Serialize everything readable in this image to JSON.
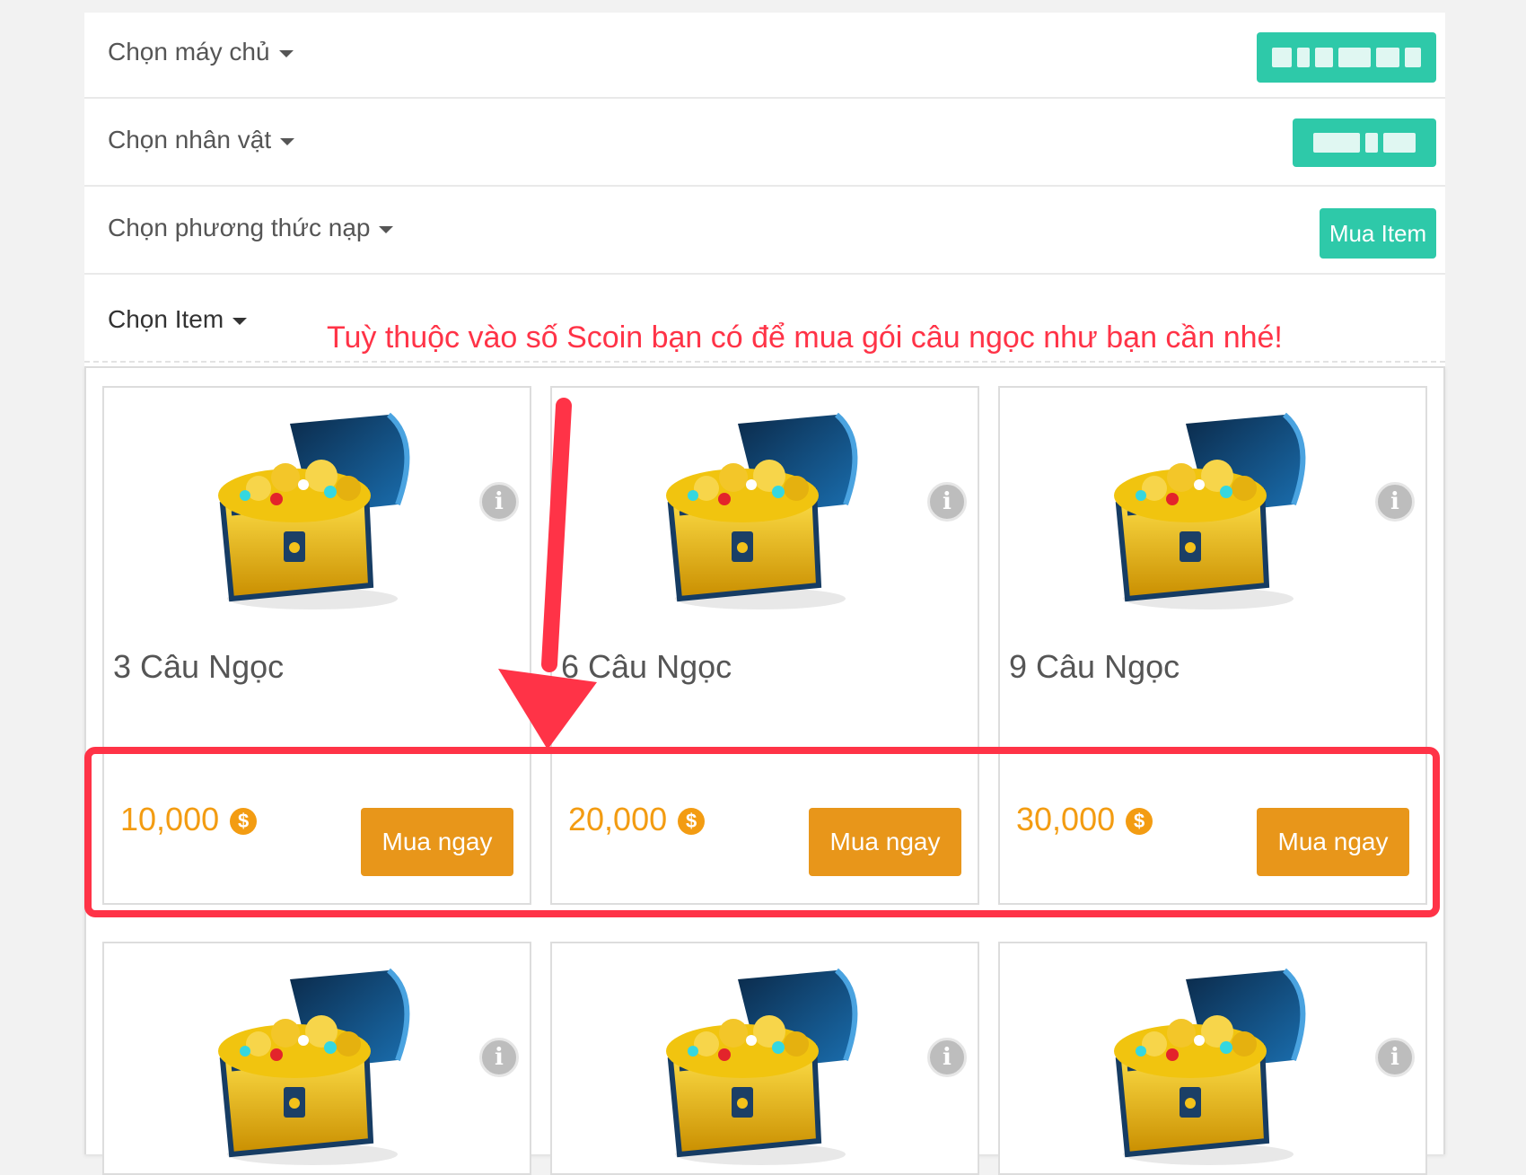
{
  "filters": {
    "server": {
      "label": "Chọn máy chủ"
    },
    "character": {
      "label": "Chọn nhân vật"
    },
    "payment_method": {
      "label": "Chọn phương thức nạp",
      "selected": "Mua Item"
    },
    "item": {
      "label": "Chọn Item"
    }
  },
  "annotation": {
    "note": "Tuỳ thuộc vào số Scoin bạn có để mua gói câu ngọc như bạn cần nhé!"
  },
  "items": [
    {
      "title": "3 Câu Ngọc",
      "price": "10,000",
      "buy_label": "Mua ngay"
    },
    {
      "title": "6 Câu Ngọc",
      "price": "20,000",
      "buy_label": "Mua ngay"
    },
    {
      "title": "9 Câu Ngọc",
      "price": "30,000",
      "buy_label": "Mua ngay"
    }
  ],
  "coin_symbol": "$",
  "info_symbol": "i",
  "colors": {
    "accent": "#2ec9a9",
    "price": "#f39c12",
    "buy": "#e8961a",
    "annotation": "#ff3347"
  }
}
